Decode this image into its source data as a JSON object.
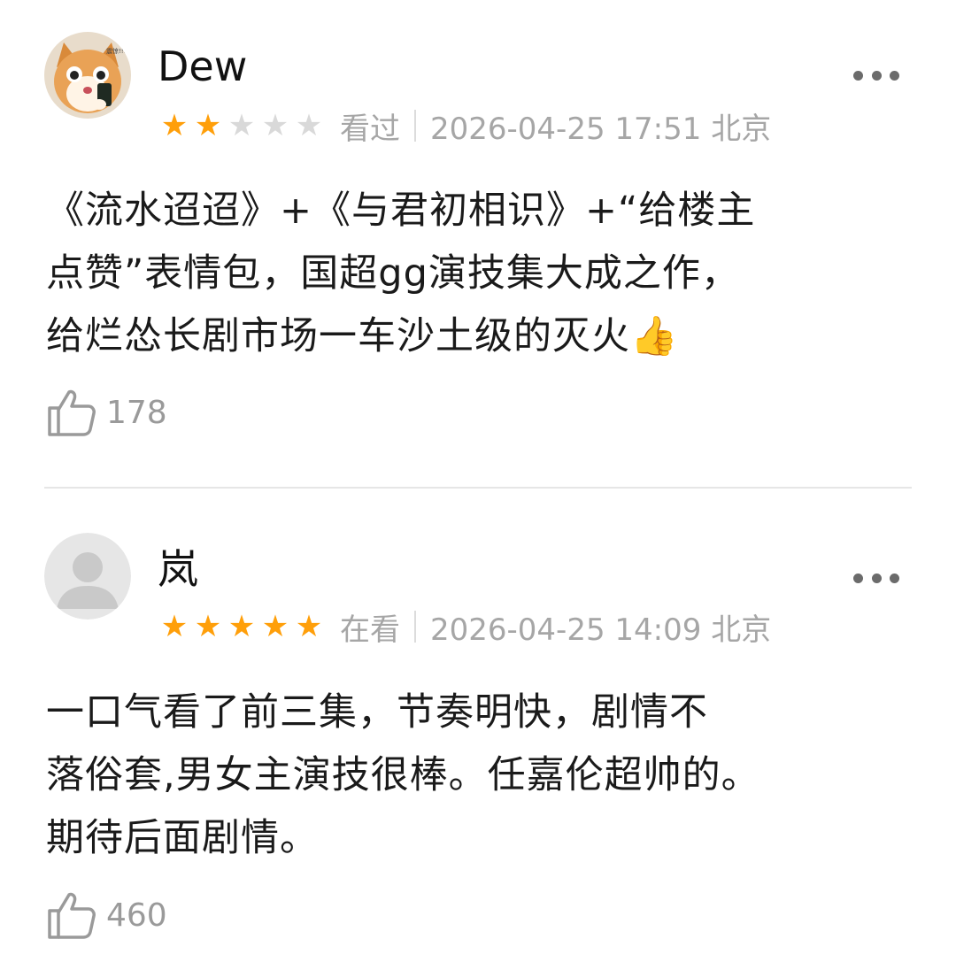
{
  "reviews": [
    {
      "username": "Dew",
      "avatar_icon": "cat-avatar-icon",
      "rating": 2,
      "max_rating": 5,
      "status": "看过",
      "time": "2026-04-25 17:51 北京",
      "content_lines": [
        "《流水迢迢》+《与君初相识》+“给楼主",
        "点赞”表情包，国超gg演技集大成之作，",
        "给烂怂长剧市场一车沙土级的灭火👍"
      ],
      "likes": "178"
    },
    {
      "username": "岚",
      "avatar_icon": "default-user-avatar-icon",
      "rating": 5,
      "max_rating": 5,
      "status": "在看",
      "time": "2026-04-25 14:09 北京",
      "content_lines": [
        "一口气看了前三集，节奏明快，剧情不",
        "落俗套,男女主演技很棒。任嘉伦超帅的。",
        "期待后面剧情。"
      ],
      "likes": "460"
    }
  ],
  "colors": {
    "star_on": "#ff9f0a",
    "star_off": "#d9d9d9",
    "meta_text": "#a6a6a6"
  }
}
